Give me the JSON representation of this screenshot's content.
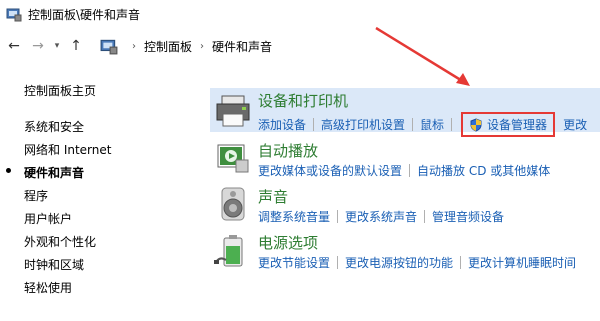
{
  "window": {
    "title": "控制面板\\硬件和声音"
  },
  "navbar": {
    "breadcrumb": [
      "控制面板",
      "硬件和声音"
    ]
  },
  "left_nav": {
    "home": "控制面板主页",
    "items": [
      "系统和安全",
      "网络和 Internet",
      "硬件和声音",
      "程序",
      "用户帐户",
      "外观和个性化",
      "时钟和区域",
      "轻松使用"
    ],
    "active_index": 2
  },
  "categories": [
    {
      "title": "设备和打印机",
      "links": [
        "添加设备",
        "高级打印机设置",
        "鼠标",
        "设备管理器",
        "更改"
      ]
    },
    {
      "title": "自动播放",
      "links": [
        "更改媒体或设备的默认设置",
        "自动播放 CD 或其他媒体"
      ]
    },
    {
      "title": "声音",
      "links": [
        "调整系统音量",
        "更改系统声音",
        "管理音频设备"
      ]
    },
    {
      "title": "电源选项",
      "links": [
        "更改节能设置",
        "更改电源按钮的功能",
        "更改计算机睡眠时间"
      ]
    }
  ],
  "colors": {
    "category_title": "#2e7d32",
    "link": "#1a5fb4",
    "highlight_box": "#e53935",
    "arrow": "#e53935"
  },
  "icons": [
    "back-arrow-icon",
    "forward-arrow-icon",
    "up-arrow-icon",
    "control-panel-icon",
    "printer-icon",
    "autoplay-icon",
    "speaker-icon",
    "battery-icon",
    "shield-icon"
  ]
}
